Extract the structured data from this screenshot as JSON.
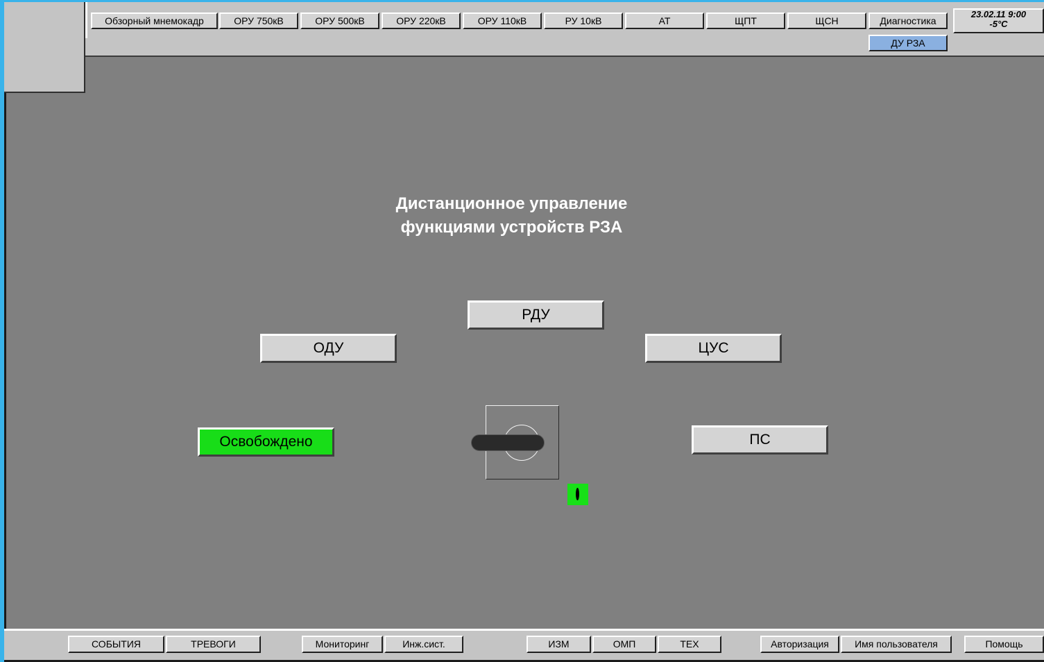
{
  "nav": {
    "tabs": [
      {
        "label": "Обзорный мнемокадр"
      },
      {
        "label": "ОРУ 750кВ"
      },
      {
        "label": "ОРУ 500кВ"
      },
      {
        "label": "ОРУ 220кВ"
      },
      {
        "label": "ОРУ 110кВ"
      },
      {
        "label": "РУ 10кВ"
      },
      {
        "label": "АТ"
      },
      {
        "label": "ЩПТ"
      },
      {
        "label": "ЩСН"
      },
      {
        "label": "Диагностика"
      }
    ],
    "sub_tab": {
      "label": "ДУ РЗА",
      "active": true
    }
  },
  "status": {
    "date": "23.02.11 9:00",
    "temperature": "-5°C"
  },
  "main": {
    "title_line1": "Дистанционное управление",
    "title_line2": "функциями устройств РЗА",
    "buttons": {
      "rdu": "РДУ",
      "odu": "ОДУ",
      "cus": "ЦУС",
      "ps": "ПС"
    },
    "release_status": "Освобождено",
    "switch_position": "horizontal"
  },
  "bottom": {
    "buttons": [
      {
        "label": "СОБЫТИЯ"
      },
      {
        "label": "ТРЕВОГИ"
      },
      {
        "label": "Мониторинг"
      },
      {
        "label": "Инж.сист."
      },
      {
        "label": "ИЗМ"
      },
      {
        "label": "ОМП"
      },
      {
        "label": "ТЕХ"
      },
      {
        "label": "Авторизация"
      },
      {
        "label": "Имя пользователя"
      },
      {
        "label": "Помощь"
      }
    ]
  },
  "colors": {
    "background": "#808080",
    "panel": "#c4c4c4",
    "active_tab": "#8ab0e0",
    "status_green": "#18dd18",
    "frame_accent": "#39b3ea"
  }
}
